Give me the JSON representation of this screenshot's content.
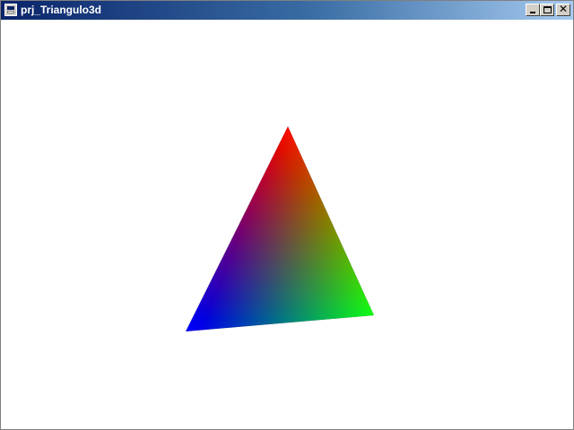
{
  "window": {
    "title": "prj_Triangulo3d",
    "icon": "app-window-icon",
    "controls": [
      {
        "name": "minimize",
        "icon": "minimize-icon"
      },
      {
        "name": "maximize",
        "icon": "maximize-icon"
      },
      {
        "name": "close",
        "icon": "close-icon",
        "glyph": "✕"
      }
    ]
  },
  "scene": {
    "background_color": "#ffffff",
    "vertex_colors": {
      "top": "#ff0000",
      "bottom_right": "#00ff00",
      "bottom_left": "#0000ff"
    }
  }
}
